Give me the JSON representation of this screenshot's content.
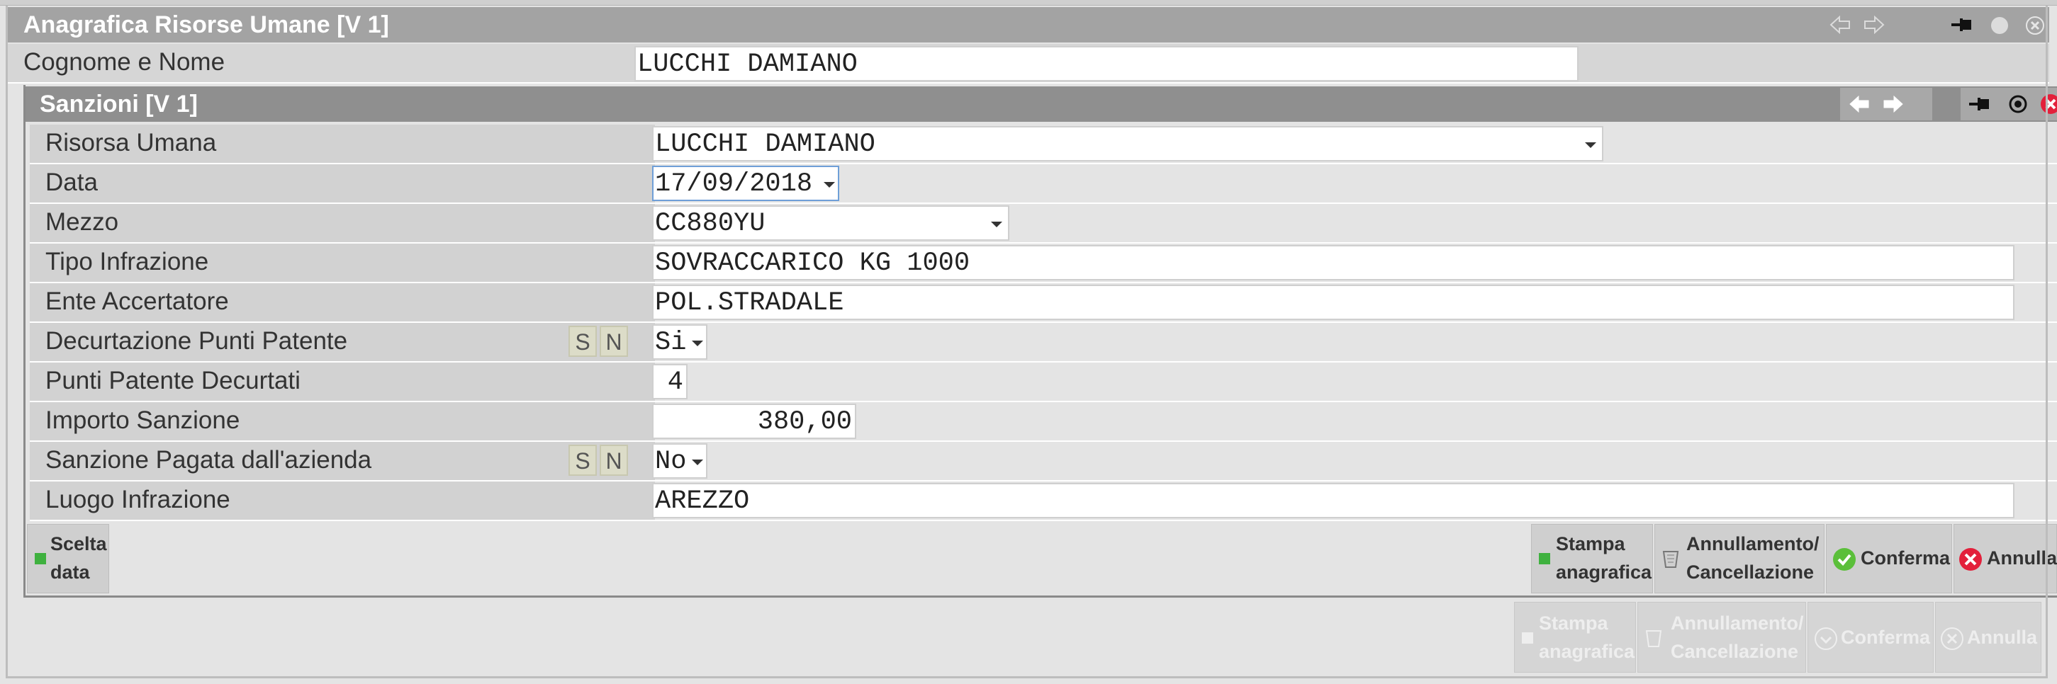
{
  "window": {
    "title": "Anagrafica Risorse Umane [V 1]"
  },
  "outer": {
    "label": "Cognome e Nome",
    "value": "LUCCHI DAMIANO"
  },
  "dialog": {
    "title": "Sanzioni [V 1]",
    "fields": {
      "risorsa": {
        "label": "Risorsa Umana",
        "value": "LUCCHI DAMIANO"
      },
      "data": {
        "label": "Data",
        "value": "17/09/2018"
      },
      "mezzo": {
        "label": "Mezzo",
        "value": "CC880YU"
      },
      "tipo": {
        "label": "Tipo Infrazione",
        "value": "SOVRACCARICO KG 1000"
      },
      "ente": {
        "label": "Ente Accertatore",
        "value": "POL.STRADALE"
      },
      "decurtazione": {
        "label": "Decurtazione Punti Patente",
        "s": "S",
        "n": "N",
        "value": "Si"
      },
      "punti": {
        "label": "Punti Patente Decurtati",
        "value": "4"
      },
      "importo": {
        "label": "Importo Sanzione",
        "value": "380,00"
      },
      "pagata": {
        "label": "Sanzione Pagata dall'azienda",
        "s": "S",
        "n": "N",
        "value": "No"
      },
      "luogo": {
        "label": "Luogo Infrazione",
        "value": "AREZZO"
      }
    },
    "buttons": {
      "scelta_l1": "Scelta",
      "scelta_l2": "data",
      "stampa_l1": "Stampa",
      "stampa_l2": "anagrafica",
      "annull_l1": "Annullamento/",
      "annull_l2": "Cancellazione",
      "conferma": "Conferma",
      "annulla": "Annulla"
    }
  },
  "bottom_buttons": {
    "stampa_l1": "Stampa",
    "stampa_l2": "anagrafica",
    "annull_l1": "Annullamento/",
    "annull_l2": "Cancellazione",
    "conferma": "Conferma",
    "annulla": "Annulla"
  },
  "colors": {
    "accent": "#3fb13f",
    "close": "#e3203b",
    "titlebar": "#a3a3a3",
    "dialog_titlebar": "#8f8f8f"
  },
  "icons": [
    "back-arrow-icon",
    "forward-arrow-icon",
    "pin-icon",
    "circle-icon",
    "close-icon",
    "dropdown-icon",
    "trash-icon",
    "check-icon"
  ]
}
